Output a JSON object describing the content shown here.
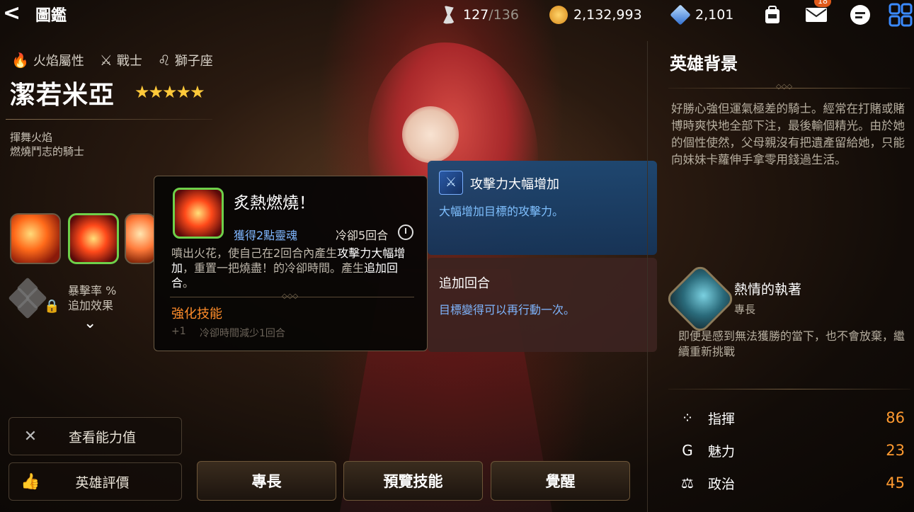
{
  "header": {
    "back_label": "<",
    "title": "圖鑑",
    "stamina_current": "127",
    "stamina_max": "/136",
    "gold": "2,132,993",
    "gems": "2,101",
    "mail_badge": "18",
    "icons": [
      "stamina-icon",
      "gold-icon",
      "gem-icon",
      "backpack-icon",
      "mail-icon",
      "chat-icon",
      "menu-grid-icon"
    ]
  },
  "hero": {
    "element": "火焰屬性",
    "class": "戰士",
    "zodiac": "獅子座",
    "name": "潔若米亞",
    "stars": "★★★★★",
    "tagline_1": "揮舞火焰",
    "tagline_2": "燃燒鬥志的騎士",
    "crit_label": "暴擊率 %",
    "extra_effect_label": "追加效果",
    "chevron": "⌄"
  },
  "side_buttons": {
    "stats": "查看能力值",
    "review": "英雄評價"
  },
  "bottom_buttons": {
    "specialty": "專長",
    "preview_skill": "預覽技能",
    "awaken": "覺醒"
  },
  "skill_popup": {
    "title": "炙熱燃燒！",
    "soul": "獲得2點靈魂",
    "cooldown": "冷卻5回合",
    "desc_1": "噴出火花，使自己在2回合內產生",
    "desc_b1": "攻擊力大幅增加",
    "desc_2": "，重置一把燒盡！的冷卻時間。產生",
    "desc_b2": "追加回合",
    "desc_3": "。",
    "enhance_title": "強化技能",
    "enhance_plus": "+1",
    "enhance_desc": "冷卻時間減少1回合"
  },
  "buffs": {
    "atk_title": "攻擊力大幅增加",
    "atk_desc": "大幅增加目標的攻擊力。",
    "extra_title": "追加回合",
    "extra_desc": "目標變得可以再行動一次。"
  },
  "background": {
    "title": "英雄背景",
    "text": "好勝心強但運氣極差的騎士。經常在打賭或賭博時爽快地全部下注，最後輸個精光。由於她的個性使然，父母親沒有把遺產留給她，只能向妹妹卡蘿伸手拿零用錢過生活。"
  },
  "specialty": {
    "name": "熱情的執著",
    "label": "專長",
    "desc": "即便是感到無法獲勝的當下，也不會放棄，繼續重新挑戰"
  },
  "stats": [
    {
      "icon": "command-icon",
      "label": "指揮",
      "value": "86"
    },
    {
      "icon": "charm-icon",
      "label": "魅力",
      "value": "23"
    },
    {
      "icon": "politics-icon",
      "label": "政治",
      "value": "45"
    }
  ],
  "colors": {
    "accent_orange": "#ff9a30",
    "buff_blue": "#1e4873",
    "skill_border_green": "#6ed04a",
    "soul_blue": "#7fb6ff"
  }
}
